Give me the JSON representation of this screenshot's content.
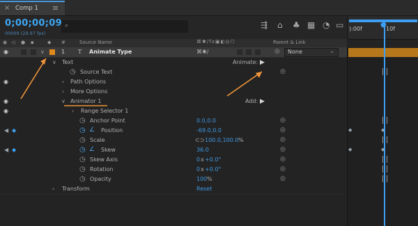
{
  "window": {
    "tab_title": "Comp 1"
  },
  "controls": {
    "timecode": "0;00;00;09",
    "fps": "00009 (29.97 fps)",
    "search_placeholder": ""
  },
  "timeline": {
    "ruler_start": "):00f",
    "ruler_end": "10f"
  },
  "headers": {
    "num": "#",
    "source_name": "Source Name",
    "parent_link": "Parent & Link"
  },
  "layer": {
    "number": "1",
    "name": "Animate Type",
    "parent": "None"
  },
  "rows": {
    "text": "Text",
    "animate": "Animate:",
    "source_text": "Source Text",
    "path_options": "Path Options",
    "more_options": "More Options",
    "animator": "Animator 1",
    "add": "Add:",
    "range_selector": "Range Selector 1",
    "anchor_point": "Anchor Point",
    "anchor_value": "0.0,0.0",
    "position": "Position",
    "position_value": "-69.0,0.0",
    "scale": "Scale",
    "scale_value": "100.0,100.0",
    "scale_unit": "%",
    "skew": "Skew",
    "skew_value": "36.0",
    "skew_axis": "Skew Axis",
    "skew_axis_value": "0",
    "skew_axis_deg": "+0.0°",
    "rotation": "Rotation",
    "rotation_value": "0",
    "rotation_deg": "+0.0°",
    "opacity": "Opacity",
    "opacity_value": "100",
    "opacity_unit": "%",
    "transform": "Transform",
    "reset": "Reset",
    "x": "x"
  },
  "colors": {
    "accent_blue": "#3ea7f3",
    "label_orange": "#e08a1e",
    "layer_bar": "#b7781c",
    "annotation": "#f0953a"
  }
}
